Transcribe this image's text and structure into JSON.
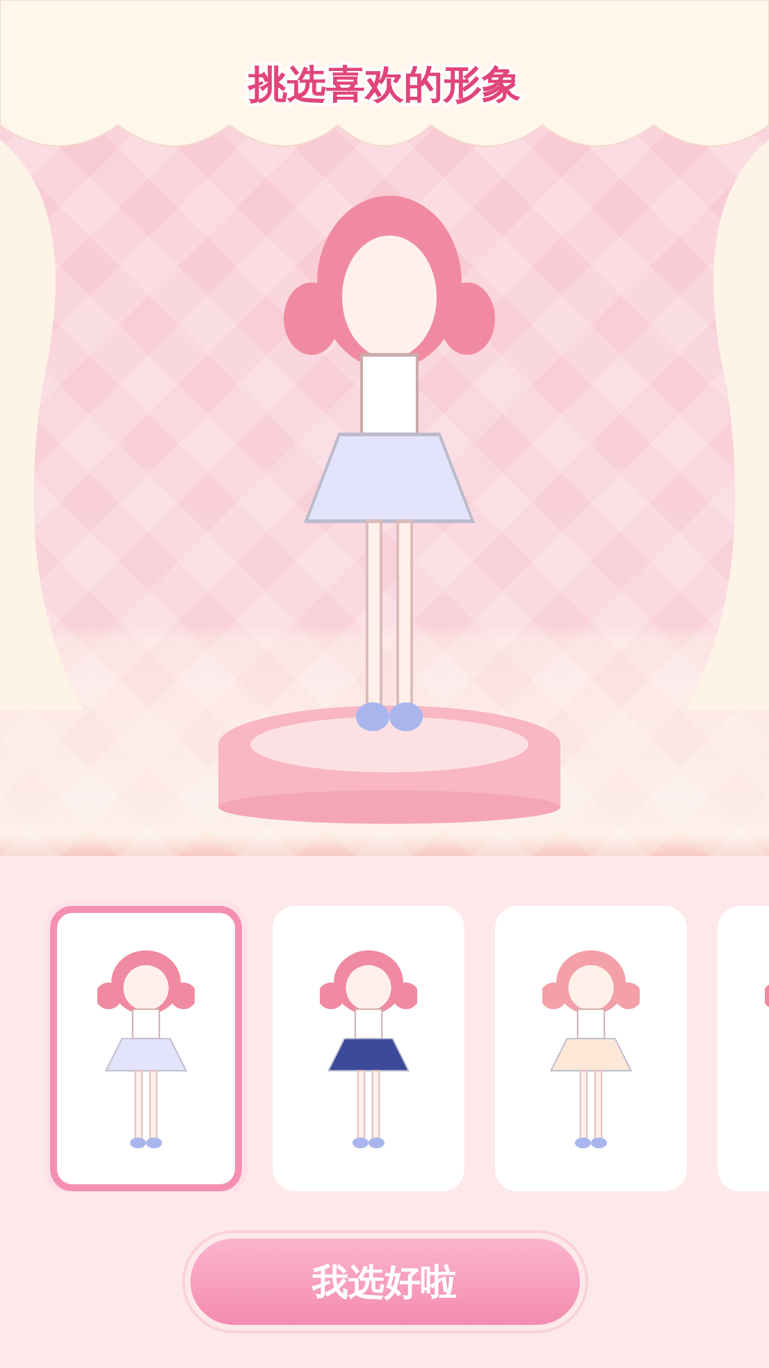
{
  "title": "挑选喜欢的形象",
  "characters": [
    {
      "selected": true
    },
    {
      "selected": false
    },
    {
      "selected": false
    },
    {
      "selected": false
    }
  ],
  "confirm_button": "我选好啦"
}
